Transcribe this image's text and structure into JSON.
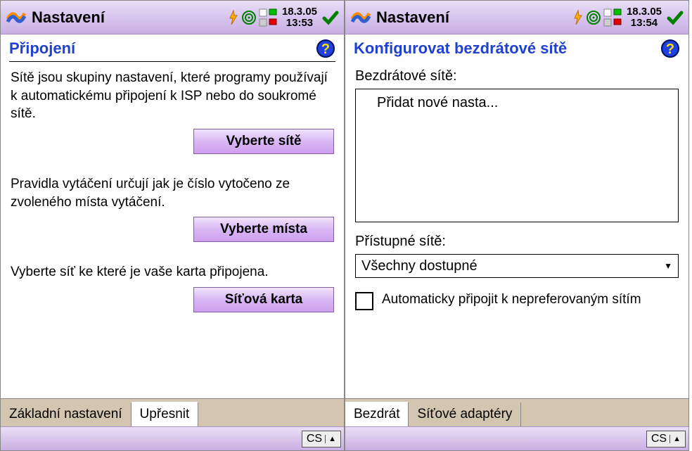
{
  "left": {
    "title": "Nastavení",
    "date": "18.3.05",
    "time": "13:53",
    "section": "Připojení",
    "para1": "Sítě jsou skupiny nastavení, které programy používají k automatickému připojení k ISP nebo do soukromé sítě.",
    "btn1": "Vyberte sítě",
    "para2": "Pravidla vytáčení určují jak je číslo vytočeno ze zvoleného místa vytáčení.",
    "btn2": "Vyberte místa",
    "para3": "Vyberte síť ke které je vaše karta připojena.",
    "btn3": "Síťová karta",
    "tabs": [
      "Základní nastavení",
      "Upřesnit"
    ],
    "active_tab": 1,
    "sip": "CS"
  },
  "right": {
    "title": "Nastavení",
    "date": "18.3.05",
    "time": "13:54",
    "section": "Konfigurovat bezdrátové sítě",
    "label_wireless": "Bezdrátové sítě:",
    "list_item": "Přidat nové nasta...",
    "label_access": "Přístupné sítě:",
    "dropdown_value": "Všechny dostupné",
    "checkbox_label": "Automaticky připojit k nepreferovaným sítím",
    "tabs": [
      "Bezdrát",
      "Síťové adaptéry"
    ],
    "active_tab": 0,
    "sip": "CS"
  }
}
